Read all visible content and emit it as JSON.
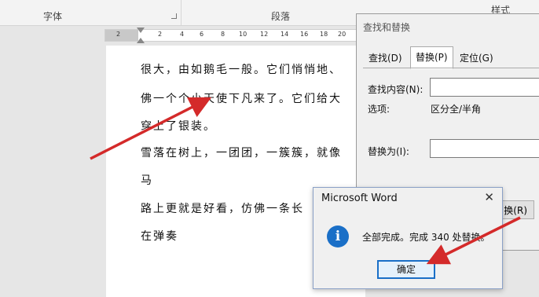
{
  "ribbon": {
    "groups": [
      "字体",
      "段落",
      "样式"
    ]
  },
  "ruler": {
    "ticks": [
      "2",
      "2",
      "4",
      "6",
      "8",
      "10",
      "12",
      "14",
      "16",
      "18",
      "20"
    ]
  },
  "document": {
    "lines": [
      "很大，由如鹅毛一般。它们悄悄地、",
      "佛一个个小天使下凡来了。它们给大",
      "穿上了银装。",
      "雪落在树上，一团团，一簇簇，就像",
      "马",
      "路上更就是好看，仿佛一条长",
      "在弹奏"
    ]
  },
  "find_dialog": {
    "title": "查找和替换",
    "tabs": [
      "查找(D)",
      "替换(P)",
      "定位(G)"
    ],
    "active_tab": 1,
    "find_label": "查找内容(N):",
    "options_label": "选项:",
    "options_value": "区分全/半角",
    "replace_label": "替换为(I):",
    "replace_all_button": "换(R)"
  },
  "message_box": {
    "title": "Microsoft Word",
    "close_glyph": "✕",
    "icon_glyph": "i",
    "message": "全部完成。完成 340 处替换。",
    "ok_button": "确定"
  },
  "colors": {
    "arrow": "#d42a2a",
    "accent": "#1a6fc7"
  }
}
